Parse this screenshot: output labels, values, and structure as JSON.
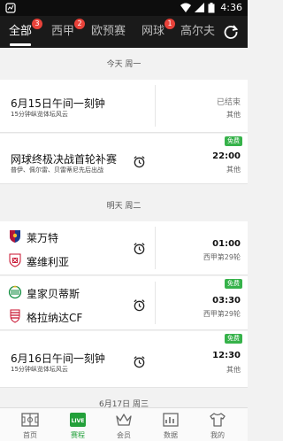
{
  "status_bar": {
    "time": "4:36"
  },
  "tabs": [
    {
      "label": "全部",
      "badge": "3"
    },
    {
      "label": "西甲",
      "badge": "2"
    },
    {
      "label": "欧预赛",
      "badge": ""
    },
    {
      "label": "网球",
      "badge": "1"
    },
    {
      "label": "高尔夫",
      "badge": ""
    }
  ],
  "sections": [
    {
      "header": "今天 周一"
    },
    {
      "header": "明天 周二"
    },
    {
      "header": "6月17日 周三"
    }
  ],
  "matches": [
    {
      "title": "6月15日午间一刻钟",
      "subtitle": "15分钟纵览体坛风云",
      "right_top": "已结束",
      "right_bottom": "其他",
      "free": ""
    },
    {
      "title": "网球终极决战首轮补赛",
      "subtitle": "普伊、佩尔雷、贝雷蒂尼先后出战",
      "right_top": "22:00",
      "right_bottom": "其他",
      "free": "免费"
    },
    {
      "team_home": "莱万特",
      "team_away": "塞维利亚",
      "right_top": "01:00",
      "right_bottom": "西甲第29轮",
      "free": ""
    },
    {
      "team_home": "皇家贝蒂斯",
      "team_away": "格拉纳达CF",
      "right_top": "03:30",
      "right_bottom": "西甲第29轮",
      "free": "免费"
    },
    {
      "title": "6月16日午间一刻钟",
      "subtitle": "15分钟纵览体坛风云",
      "right_top": "12:30",
      "right_bottom": "其他",
      "free": "免费"
    }
  ],
  "bottom_nav": [
    {
      "label": "首页",
      "icon": "field-icon"
    },
    {
      "label": "赛程",
      "icon": "live-icon",
      "icon_text": "LIVE"
    },
    {
      "label": "会员",
      "icon": "crown-icon"
    },
    {
      "label": "数据",
      "icon": "chart-icon"
    },
    {
      "label": "我的",
      "icon": "shirt-icon"
    }
  ],
  "colors": {
    "accent": "#23a03a",
    "free_badge": "#36b24a",
    "tab_badge": "#e8423a",
    "tabbar_bg": "#1a1a1a"
  }
}
